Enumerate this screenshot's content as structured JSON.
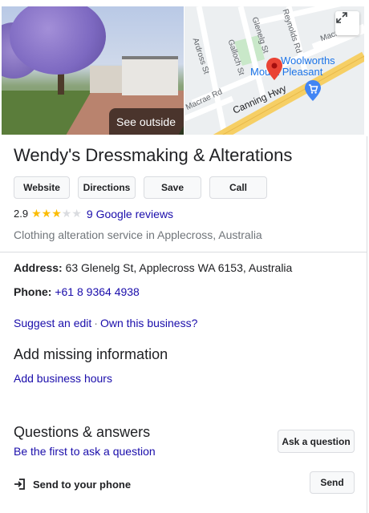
{
  "header": {
    "see_outside": "See outside",
    "map_labels": {
      "glenelg": "Glenelg St",
      "reynolds": "Reynolds Rd",
      "macrae_top": "Macrae R",
      "ardross": "Ardross St",
      "galloch": "Galloch St",
      "macrae_left": "Macrae Rd",
      "poi_line1": "Woolworths",
      "poi_line2": "Mount Pleasant",
      "highway": "Canning Hwy"
    }
  },
  "business": {
    "name": "Wendy's Dressmaking & Alterations",
    "buttons": {
      "website": "Website",
      "directions": "Directions",
      "save": "Save",
      "call": "Call"
    },
    "rating_value": "2.9",
    "stars_filled": 3,
    "stars_total": 5,
    "reviews_link": "9 Google reviews",
    "category": "Clothing alteration service in Applecross, Australia"
  },
  "details": {
    "address_label": "Address:",
    "address_value": "63 Glenelg St, Applecross WA 6153, Australia",
    "phone_label": "Phone:",
    "phone_value": "+61 8 9364 4938",
    "suggest_edit": "Suggest an edit",
    "separator": "·",
    "own_business": "Own this business?"
  },
  "missing_info": {
    "heading": "Add missing information",
    "add_hours": "Add business hours"
  },
  "qa": {
    "heading": "Questions & answers",
    "first_ask": "Be the first to ask a question",
    "ask_button": "Ask a question"
  },
  "send": {
    "label": "Send to your phone",
    "button": "Send"
  },
  "colors": {
    "link": "#1a0dab",
    "star": "#fbbc04",
    "pin": "#ea4335",
    "highway": "#f6cf65"
  }
}
